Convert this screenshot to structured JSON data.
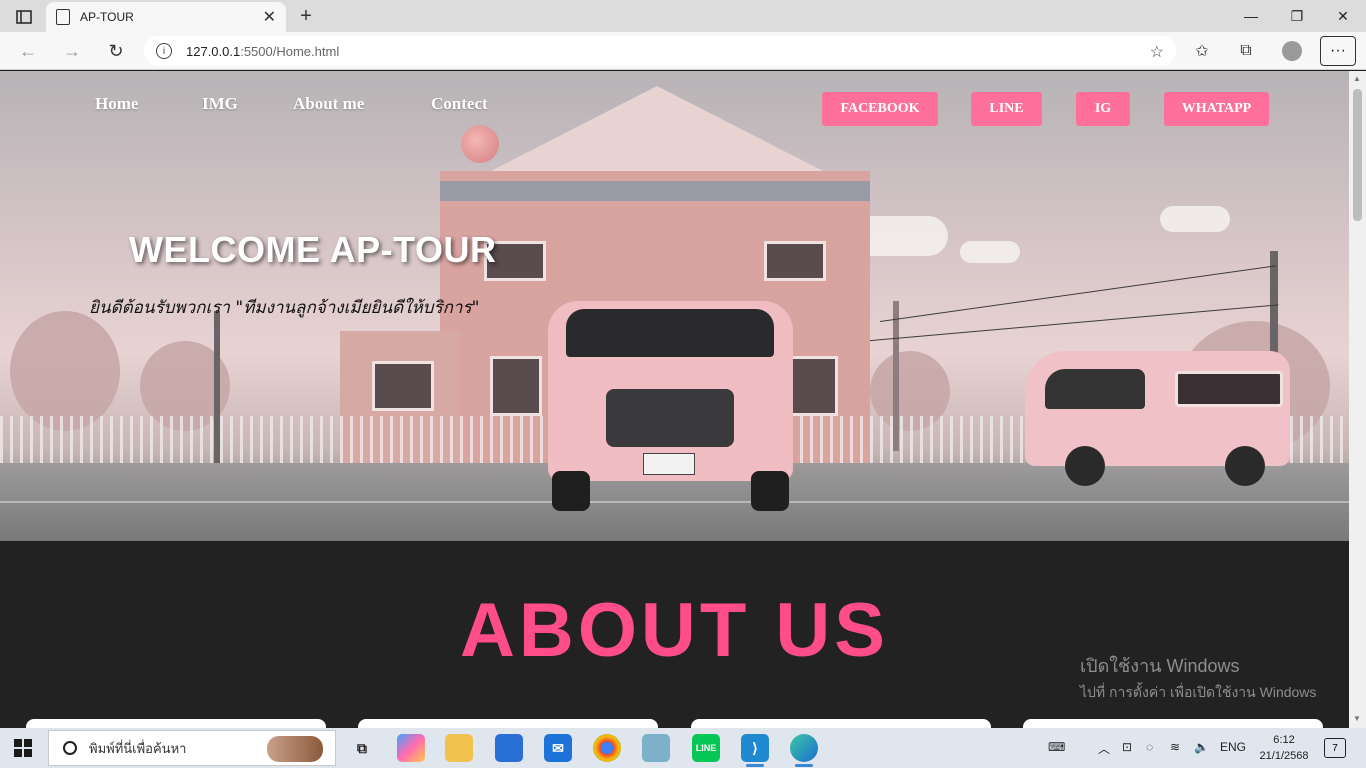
{
  "browser": {
    "tab_title": "AP-TOUR",
    "url_host": "127.0.0.1",
    "url_rest": ":5500/Home.html"
  },
  "site": {
    "nav": [
      "Home",
      "IMG",
      "About me",
      "Contect"
    ],
    "social": [
      "FACEBOOK",
      "LINE",
      "IG",
      "WHATAPP"
    ],
    "welcome": "WELCOME AP-TOUR",
    "tagline": "ยินดีต้อนรับพวกเรา \"ทีมงานลูกจ้างเมียยินดีให้บริการ\"",
    "about_title": "ABOUT US",
    "accent_color": "#ff4d8a",
    "button_color": "#ff6f9c"
  },
  "watermark": {
    "line1": "เปิดใช้งาน Windows",
    "line2": "ไปที่ การตั้งค่า เพื่อเปิดใช้งาน Windows"
  },
  "taskbar": {
    "search_placeholder": "พิมพ์ที่นี่เพื่อค้นหา",
    "language": "ENG",
    "time": "6:12",
    "date": "21/1/2568",
    "notification_count": "7"
  }
}
